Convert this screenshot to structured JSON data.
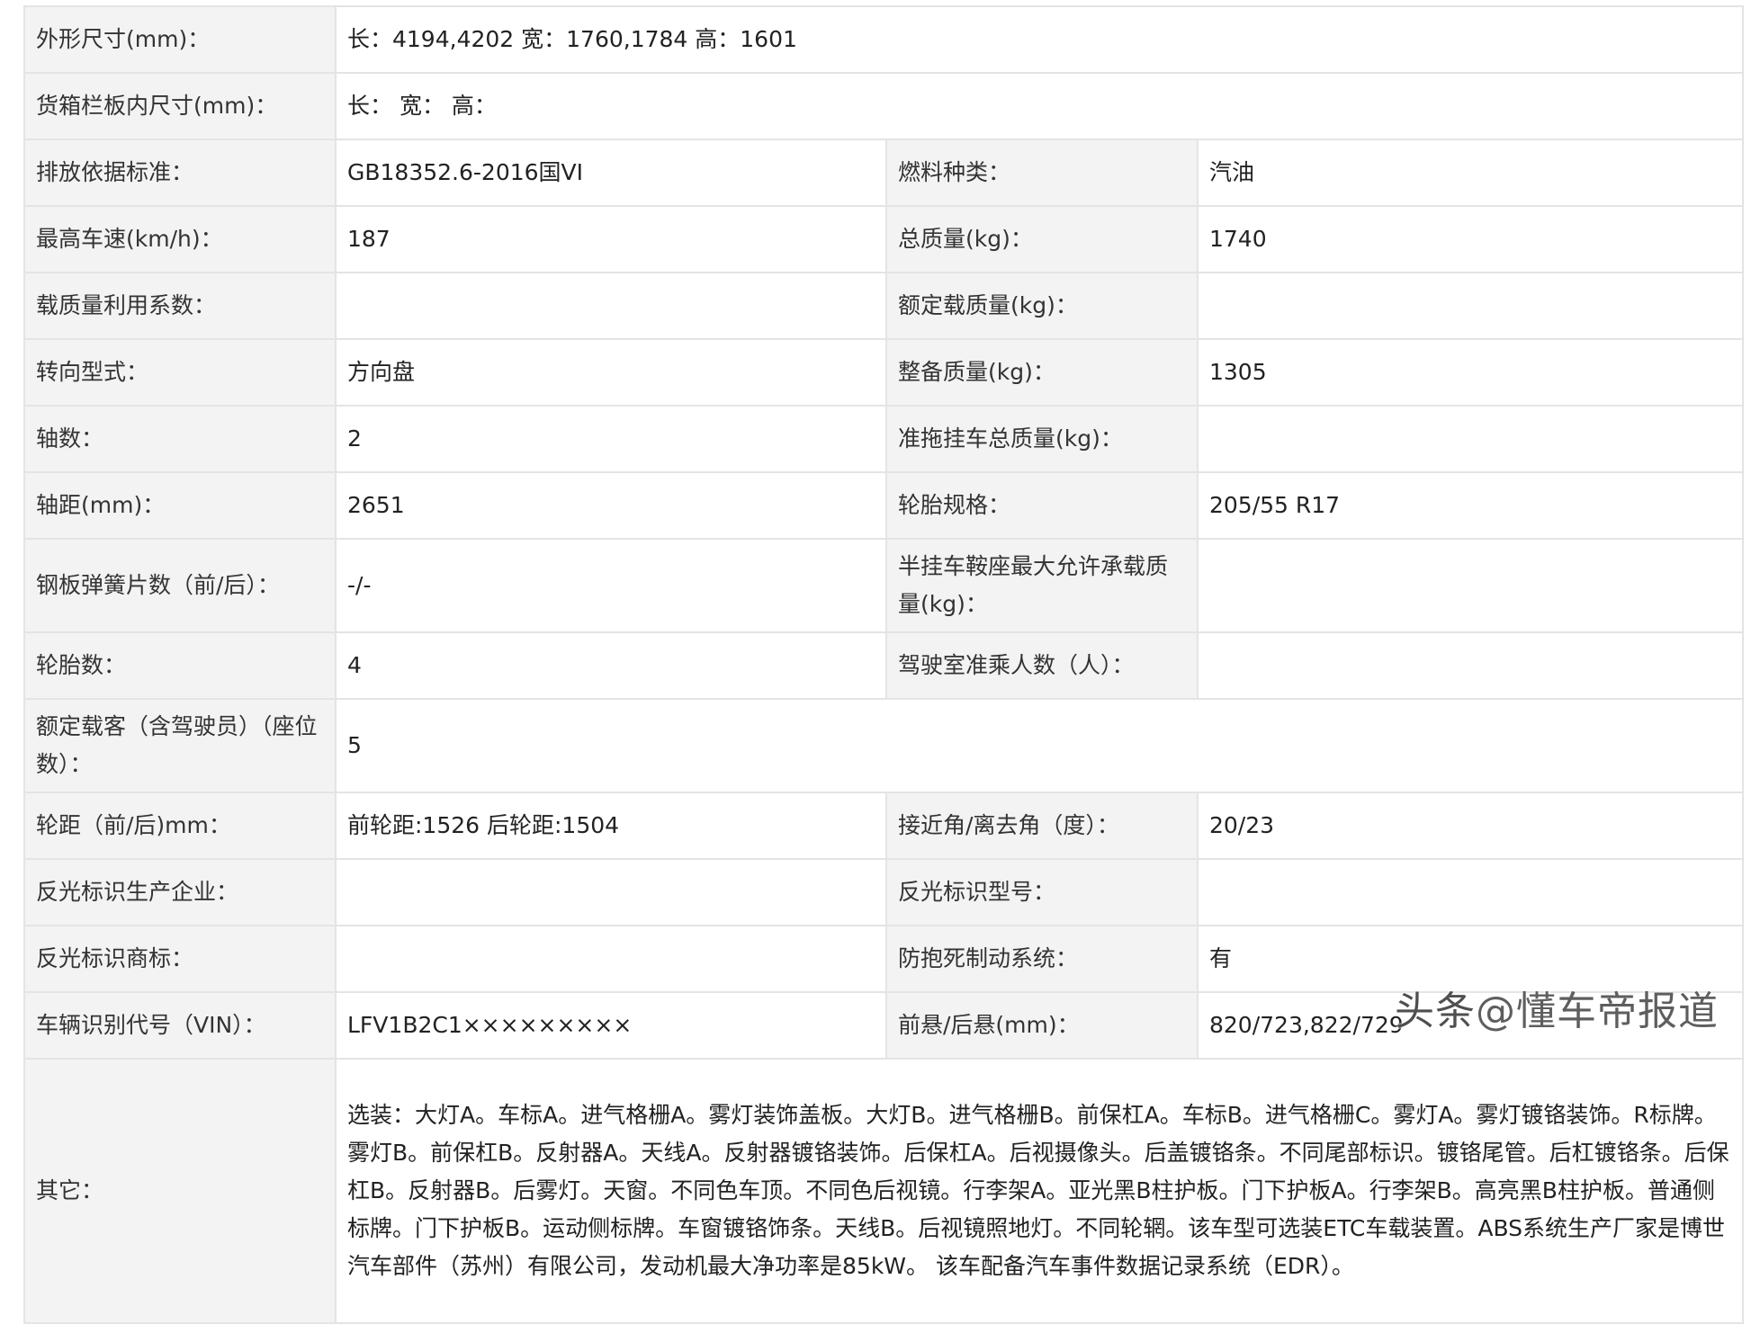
{
  "rows": [
    {
      "label": "外形尺寸(mm)：",
      "value": "长：4194,4202 宽：1760,1784 高：1601"
    },
    {
      "label": "货箱栏板内尺寸(mm)：",
      "value": "长： 宽： 高："
    },
    {
      "label": "排放依据标准：",
      "value": "GB18352.6-2016国VI",
      "label2": "燃料种类：",
      "value2": "汽油"
    },
    {
      "label": "最高车速(km/h)：",
      "value": "187",
      "label2": "总质量(kg)：",
      "value2": "1740"
    },
    {
      "label": "载质量利用系数：",
      "value": "",
      "label2": "额定载质量(kg)：",
      "value2": ""
    },
    {
      "label": "转向型式：",
      "value": "方向盘",
      "label2": "整备质量(kg)：",
      "value2": "1305"
    },
    {
      "label": "轴数：",
      "value": "2",
      "label2": "准拖挂车总质量(kg)：",
      "value2": ""
    },
    {
      "label": "轴距(mm)：",
      "value": "2651",
      "label2": "轮胎规格：",
      "value2": "205/55 R17"
    },
    {
      "label": "钢板弹簧片数（前/后）：",
      "value": "-/-",
      "label2": "半挂车鞍座最大允许承载质量(kg)：",
      "value2": ""
    },
    {
      "label": "轮胎数：",
      "value": "4",
      "label2": "驾驶室准乘人数（人）：",
      "value2": ""
    },
    {
      "label": "额定载客（含驾驶员）（座位数）：",
      "value": "5"
    },
    {
      "label": "轮距（前/后)mm：",
      "value": "前轮距:1526 后轮距:1504",
      "label2": "接近角/离去角（度）：",
      "value2": "20/23"
    },
    {
      "label": "反光标识生产企业：",
      "value": "",
      "label2": "反光标识型号：",
      "value2": ""
    },
    {
      "label": "反光标识商标：",
      "value": "",
      "label2": "防抱死制动系统：",
      "value2": "有"
    },
    {
      "label": "车辆识别代号（VIN）：",
      "value": "LFV1B2C1×××××××××",
      "label2": "前悬/后悬(mm)：",
      "value2": "820/723,822/729"
    },
    {
      "label": "其它：",
      "value": "选装：大灯A。车标A。进气格栅A。雾灯装饰盖板。大灯B。进气格栅B。前保杠A。车标B。进气格栅C。雾灯A。雾灯镀铬装饰。R标牌。雾灯B。前保杠B。反射器A。天线A。反射器镀铬装饰。后保杠A。后视摄像头。后盖镀铬条。不同尾部标识。镀铬尾管。后杠镀铬条。后保杠B。反射器B。后雾灯。天窗。不同色车顶。不同色后视镜。行李架A。亚光黑B柱护板。门下护板A。行李架B。高亮黑B柱护板。普通侧标牌。门下护板B。运动侧标牌。车窗镀铬饰条。天线B。后视镜照地灯。不同轮辋。该车型可选装ETC车载装置。ABS系统生产厂家是博世汽车部件（苏州）有限公司，发动机最大净功率是85kW。 该车配备汽车事件数据记录系统（EDR）。"
    }
  ],
  "watermark": {
    "prefix": "头条",
    "handle": "@懂车帝报道"
  }
}
